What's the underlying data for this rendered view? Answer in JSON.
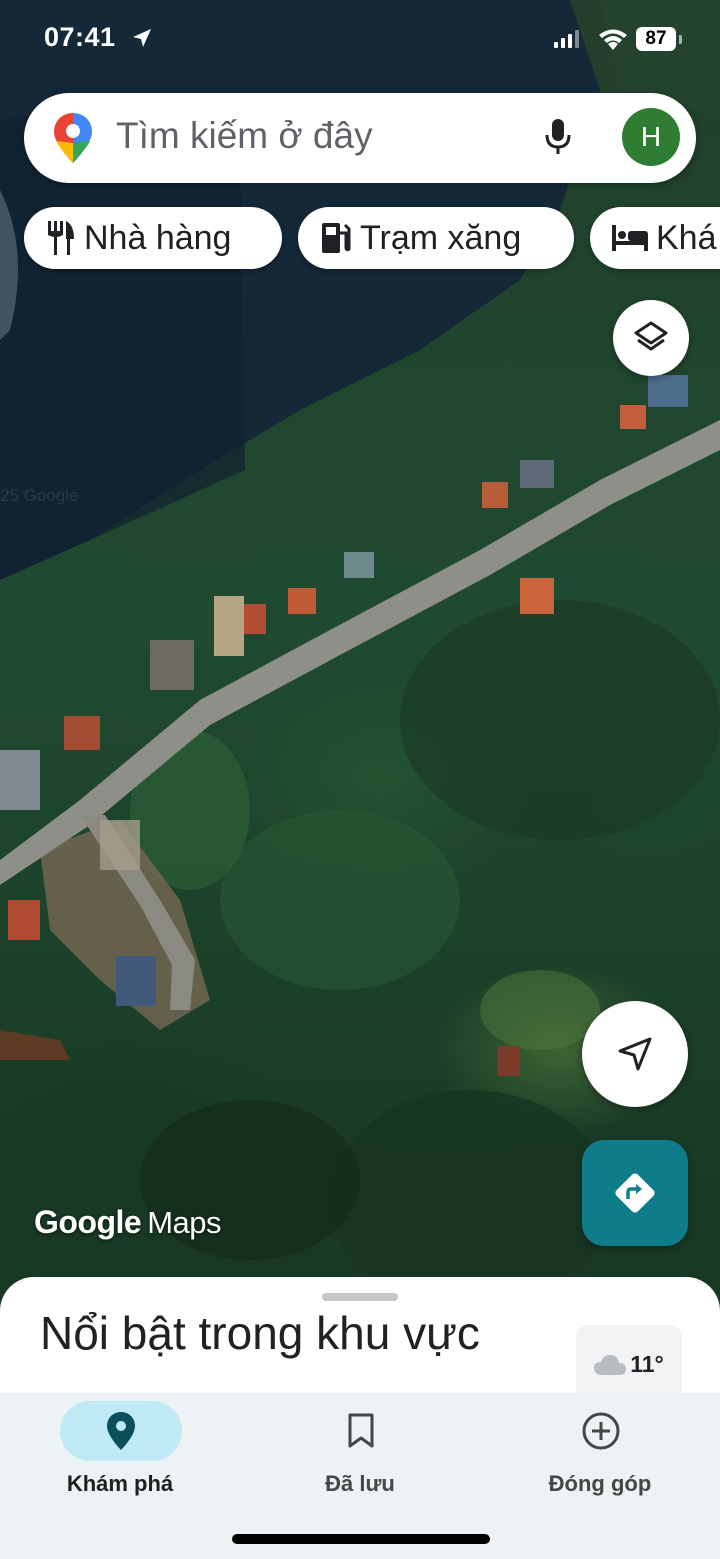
{
  "status_bar": {
    "time": "07:41",
    "battery": "87"
  },
  "search": {
    "placeholder": "Tìm kiếm ở đây",
    "avatar_initial": "H"
  },
  "chips": [
    {
      "label": "Nhà hàng",
      "icon": "restaurant-icon"
    },
    {
      "label": "Trạm xăng",
      "icon": "gas-station-icon"
    },
    {
      "label": "Khá",
      "icon": "hotel-icon"
    }
  ],
  "map": {
    "watermark": "25 Google",
    "logo_google": "Google",
    "logo_maps": "Maps"
  },
  "sheet": {
    "title": "Nổi bật trong khu vực",
    "weather_temp": "11°",
    "weather_icon": "cloud-icon"
  },
  "bottom_nav": {
    "items": [
      {
        "label": "Khám phá",
        "icon": "explore-pin-icon",
        "active": true
      },
      {
        "label": "Đã lưu",
        "icon": "bookmark-icon",
        "active": false
      },
      {
        "label": "Đóng góp",
        "icon": "add-circle-icon",
        "active": false
      }
    ]
  },
  "colors": {
    "accent": "#0f7c8c",
    "avatar": "#2e7d32",
    "active_nav_pill": "#bfeaf5"
  }
}
